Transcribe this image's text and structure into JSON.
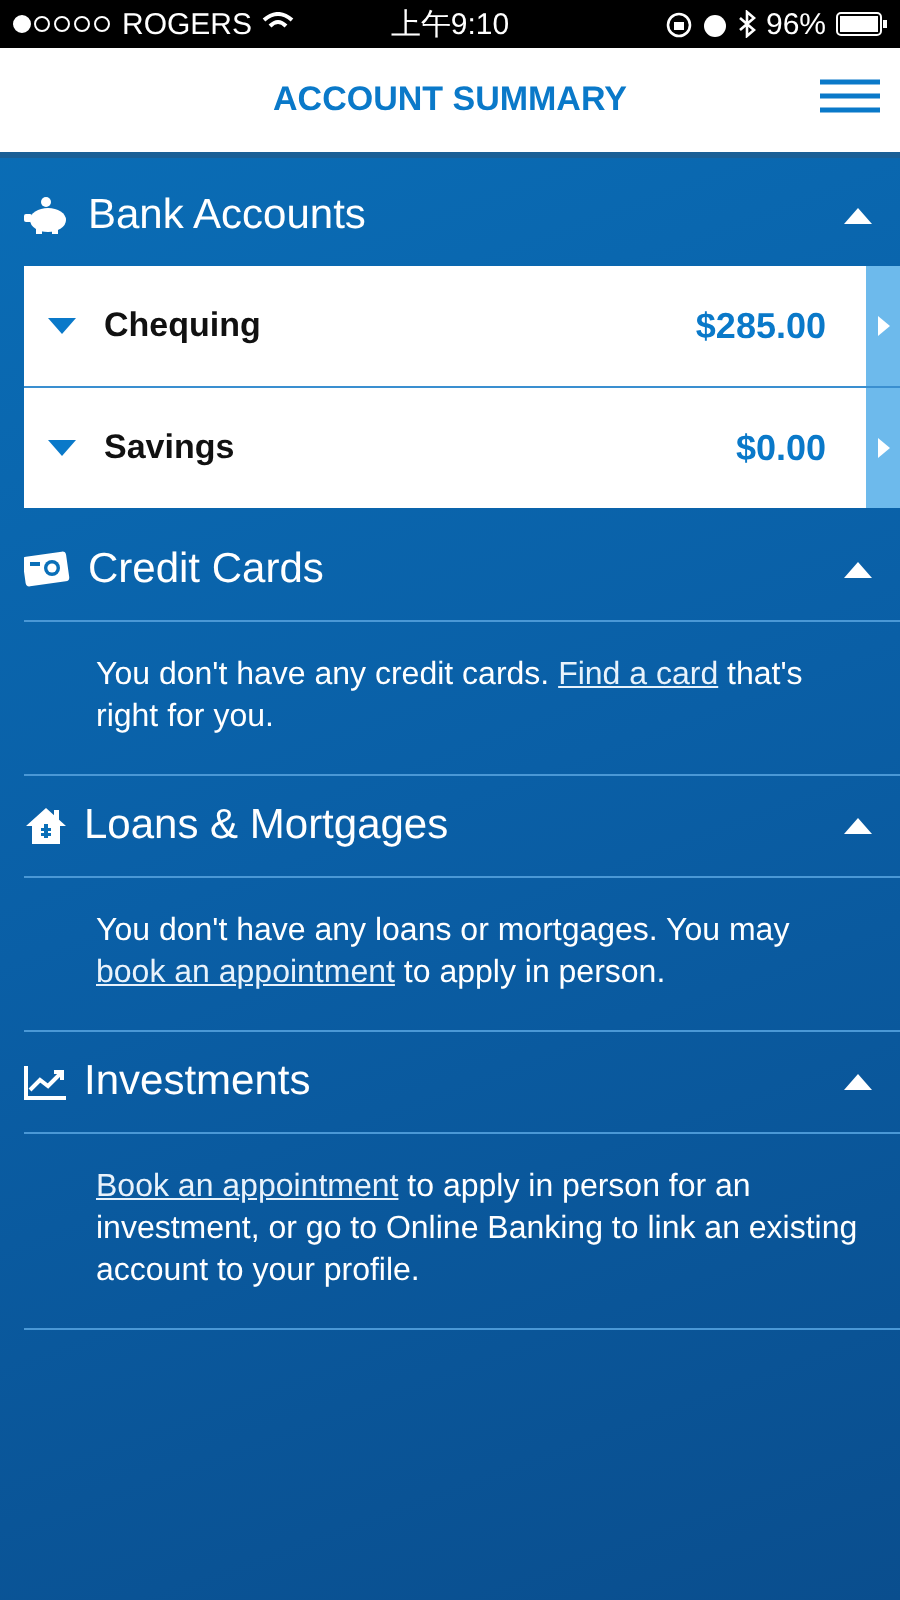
{
  "status_bar": {
    "carrier": "ROGERS",
    "time": "上午9:10",
    "battery": "96%"
  },
  "header": {
    "title": "ACCOUNT SUMMARY"
  },
  "sections": [
    {
      "kind": "accounts",
      "title": "Bank Accounts",
      "expanded": true,
      "accounts": [
        {
          "name": "Chequing",
          "balance": "$285.00",
          "expanded": false
        },
        {
          "name": "Savings",
          "balance": "$0.00",
          "expanded": false
        }
      ]
    },
    {
      "kind": "message",
      "title": "Credit Cards",
      "expanded": true,
      "message": [
        {
          "kind": "text",
          "text": "You don't have any credit cards. "
        },
        {
          "kind": "link",
          "text": "Find a card"
        },
        {
          "kind": "text",
          "text": " that's right for you."
        }
      ]
    },
    {
      "kind": "message",
      "title": "Loans & Mortgages",
      "expanded": true,
      "message": [
        {
          "kind": "text",
          "text": "You don't have any loans or mortgages. You may "
        },
        {
          "kind": "link",
          "text": "book an appointment"
        },
        {
          "kind": "text",
          "text": " to apply in person."
        }
      ]
    },
    {
      "kind": "message",
      "title": "Investments",
      "expanded": true,
      "message": [
        {
          "kind": "link",
          "text": "Book an appointment"
        },
        {
          "kind": "text",
          "text": " to apply in person for an investment, or go to Online Banking to link an existing account to your profile."
        }
      ]
    }
  ]
}
